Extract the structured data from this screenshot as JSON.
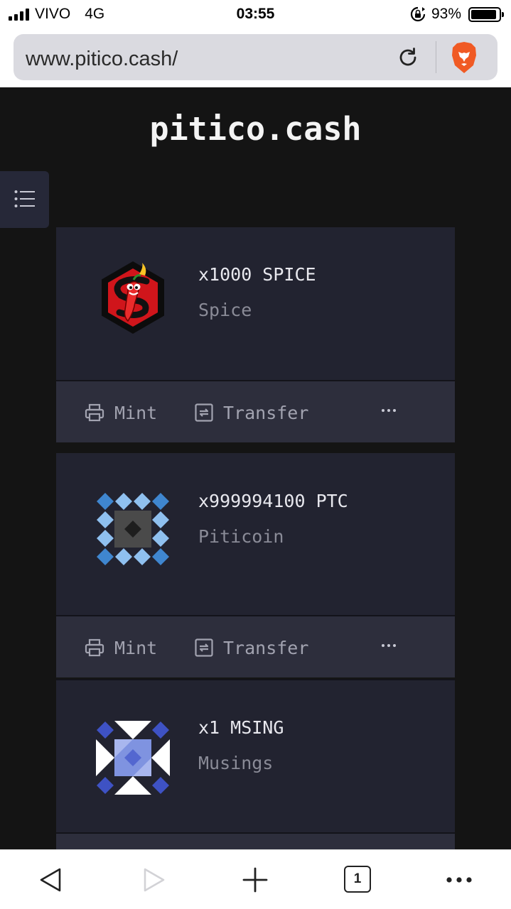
{
  "status_bar": {
    "carrier": "VIVO",
    "network": "4G",
    "time": "03:55",
    "battery_percent": "93%",
    "battery_level": 0.93
  },
  "browser": {
    "url": "www.pitico.cash/",
    "icons": [
      "reload-icon",
      "brave-lion-icon"
    ]
  },
  "page": {
    "site_title": "pitico.cash",
    "menu_icon": "list-icon"
  },
  "tokens": [
    {
      "amount": "x1000 SPICE",
      "name": "Spice",
      "icon": "spice-chili-logo",
      "actions": {
        "mint": "Mint",
        "transfer": "Transfer"
      }
    },
    {
      "amount": "x999994100 PTC",
      "name": "Piticoin",
      "icon": "piticoin-pattern-logo",
      "actions": {
        "mint": "Mint",
        "transfer": "Transfer"
      }
    },
    {
      "amount": "x1 MSING",
      "name": "Musings",
      "icon": "musings-pattern-logo"
    }
  ],
  "toolbar": {
    "tab_count": "1",
    "icons": [
      "back-icon",
      "forward-icon",
      "new-tab-icon",
      "tabs-icon",
      "more-icon"
    ]
  },
  "colors": {
    "page_bg": "#141414",
    "card_bg": "#222330",
    "card_footer_bg": "#2d2e3c",
    "brave_orange": "#f05a24",
    "ptc_blue": "#4a90d9",
    "msing_blue": "#3e52c4"
  }
}
